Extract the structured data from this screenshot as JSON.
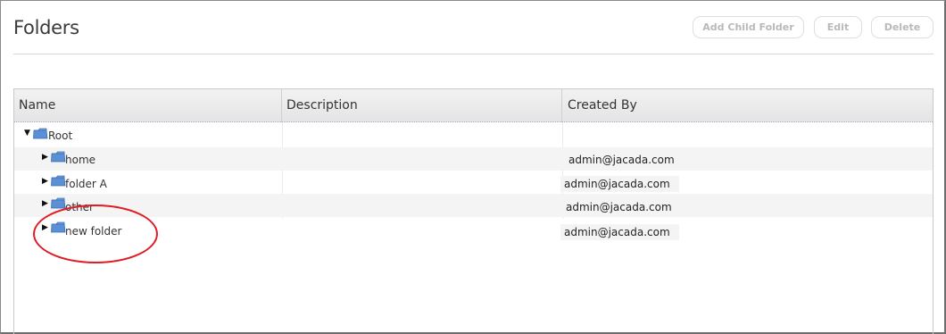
{
  "page": {
    "title": "Folders"
  },
  "toolbar": {
    "add_child_label": "Add Child Folder",
    "edit_label": "Edit",
    "delete_label": "Delete"
  },
  "grid": {
    "columns": [
      "Name",
      "Description",
      "Created By"
    ],
    "rows": [
      {
        "name": "Root",
        "description": "",
        "created_by": "",
        "expanded": true,
        "level": 0
      },
      {
        "name": "home",
        "description": "",
        "created_by": "admin@jacada.com",
        "expanded": false,
        "level": 1
      },
      {
        "name": "folder A",
        "description": "",
        "created_by": "admin@jacada.com",
        "expanded": false,
        "level": 1
      },
      {
        "name": "other",
        "description": "",
        "created_by": "admin@jacada.com",
        "expanded": false,
        "level": 1
      },
      {
        "name": "new folder",
        "description": "",
        "created_by": "admin@jacada.com",
        "expanded": false,
        "level": 1
      }
    ]
  },
  "icons": {
    "expanded": "triangle-down-icon",
    "collapsed": "triangle-right-icon",
    "folder": "folder-icon"
  },
  "colors": {
    "folder_blue": "#5b8fd6",
    "annotation_red": "#e01b24"
  }
}
